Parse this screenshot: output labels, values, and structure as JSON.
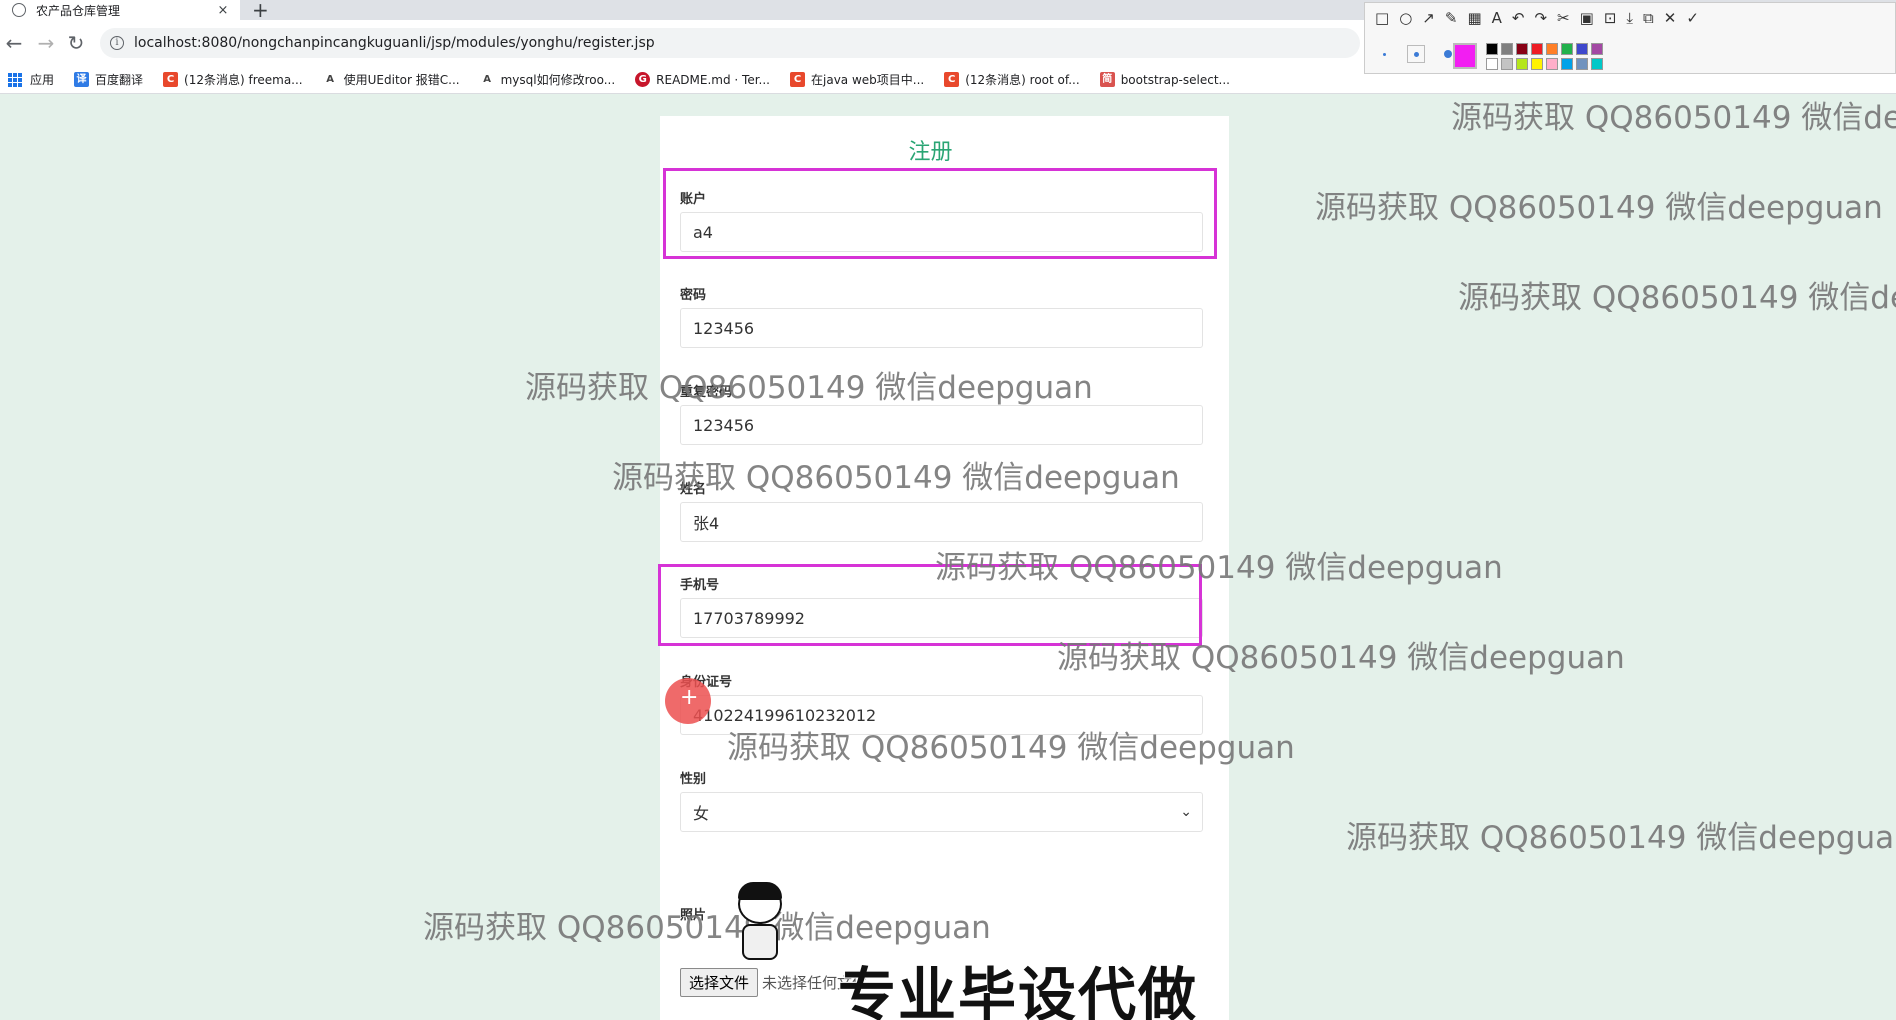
{
  "browser": {
    "tab_title": "农产品仓库管理",
    "tab_close": "×",
    "new_tab": "+",
    "url": "localhost:8080/nongchanpincangkuguanli/jsp/modules/yonghu/register.jsp",
    "bookmarks": [
      {
        "label": "应用",
        "icon_color": "#1a73e8"
      },
      {
        "label": "百度翻译",
        "icon_color": "#2f7be5",
        "icon_text": "译"
      },
      {
        "label": "(12条消息) freema...",
        "icon_color": "#e8482c",
        "icon_text": "C"
      },
      {
        "label": "使用UEditor 报错C...",
        "icon_color": "#444444",
        "icon_text": "A"
      },
      {
        "label": "mysql如何修改roo...",
        "icon_color": "#444444",
        "icon_text": "A"
      },
      {
        "label": "README.md · Ter...",
        "icon_color": "#c7162b",
        "icon_text": "G"
      },
      {
        "label": "在java web项目中...",
        "icon_color": "#e8482c",
        "icon_text": "C"
      },
      {
        "label": "(12条消息) root of...",
        "icon_color": "#e8482c",
        "icon_text": "C"
      },
      {
        "label": "bootstrap-select...",
        "icon_color": "#d9534f",
        "icon_text": "简"
      }
    ]
  },
  "annotation_toolbar": {
    "current_color": "#f21ef2",
    "palette": [
      "#000000",
      "#7f7f7f",
      "#880015",
      "#ed1c24",
      "#ff7f27",
      "#22b14c",
      "#3f48cc",
      "#a349a4",
      "#ffffff",
      "#c3c3c3",
      "#b5e61d",
      "#fff200",
      "#ffaec9",
      "#00a2e8",
      "#7092be",
      "#00c8c8"
    ]
  },
  "form": {
    "title": "注册",
    "account": {
      "label": "账户",
      "value": "a4"
    },
    "password": {
      "label": "密码",
      "value": "123456"
    },
    "repeat_password": {
      "label": "重复密码",
      "value": "123456"
    },
    "name": {
      "label": "姓名",
      "value": "张4"
    },
    "phone": {
      "label": "手机号",
      "value": "17703789992"
    },
    "id_number": {
      "label": "身份证号",
      "value": "410224199610232012"
    },
    "gender": {
      "label": "性别",
      "value": "女"
    },
    "photo": {
      "label": "照片",
      "button": "选择文件",
      "status": "未选择任何文件"
    }
  },
  "watermark_text": "源码获取 QQ86050149 微信deepguan",
  "promo_text": "专业毕设代做",
  "colors": {
    "page_background": "#e4f1ea",
    "title_green": "#2aa574",
    "annotation_pink": "#d633d6"
  }
}
